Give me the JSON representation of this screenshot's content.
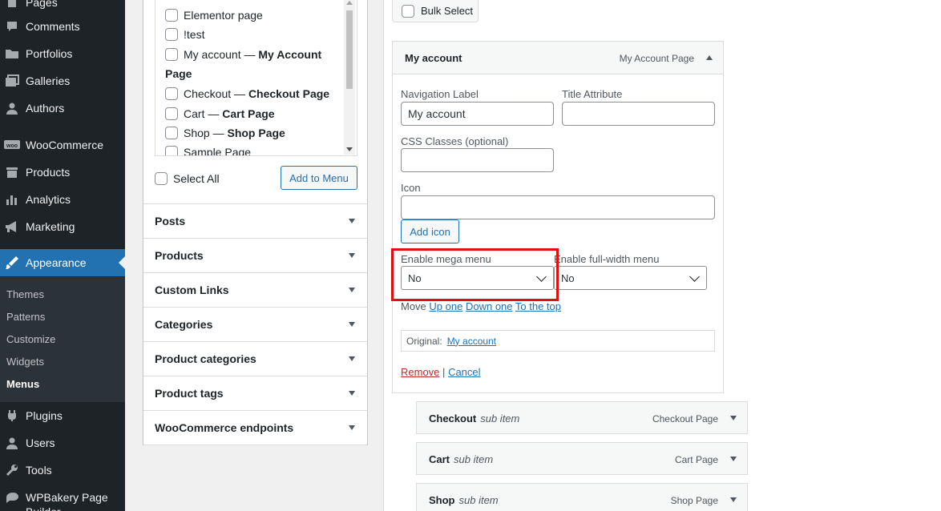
{
  "sidebar": {
    "items": [
      {
        "label": "Pages",
        "icon": "pages-icon"
      },
      {
        "label": "Comments",
        "icon": "comments-icon"
      },
      {
        "label": "Portfolios",
        "icon": "portfolio-icon"
      },
      {
        "label": "Galleries",
        "icon": "galleries-icon"
      },
      {
        "label": "Authors",
        "icon": "authors-icon"
      },
      {
        "label": "WooCommerce",
        "icon": "woocommerce-icon"
      },
      {
        "label": "Products",
        "icon": "products-icon"
      },
      {
        "label": "Analytics",
        "icon": "analytics-icon"
      },
      {
        "label": "Marketing",
        "icon": "marketing-icon"
      },
      {
        "label": "Appearance",
        "icon": "appearance-icon"
      },
      {
        "label": "Plugins",
        "icon": "plugins-icon"
      },
      {
        "label": "Users",
        "icon": "users-icon"
      },
      {
        "label": "Tools",
        "icon": "tools-icon"
      },
      {
        "label": "WPBakery Page Builder",
        "icon": "wpbakery-icon"
      }
    ],
    "submenu": [
      "Themes",
      "Patterns",
      "Customize",
      "Widgets",
      "Menus"
    ],
    "current": "Appearance",
    "current_sub": "Menus"
  },
  "pages_box": {
    "items": [
      {
        "plain": "Elementor page",
        "bold": ""
      },
      {
        "plain": "!test",
        "bold": ""
      },
      {
        "plain": "My account — ",
        "bold": "My Account"
      },
      {
        "plain": "",
        "bold": "Page"
      },
      {
        "plain": "Checkout — ",
        "bold": "Checkout Page"
      },
      {
        "plain": "Cart — ",
        "bold": "Cart Page"
      },
      {
        "plain": "Shop — ",
        "bold": "Shop Page"
      },
      {
        "plain": "Sample Page",
        "bold": ""
      }
    ],
    "select_all_label": "Select All",
    "add_to_menu_label": "Add to Menu"
  },
  "accordion": [
    "Posts",
    "Products",
    "Custom Links",
    "Categories",
    "Product categories",
    "Product tags",
    "WooCommerce endpoints"
  ],
  "bulk_select_label": "Bulk Select",
  "menu_item": {
    "title": "My account",
    "type": "My Account Page",
    "nav_label_label": "Navigation Label",
    "nav_label_value": "My account",
    "title_attr_label": "Title Attribute",
    "title_attr_value": "",
    "css_classes_label": "CSS Classes (optional)",
    "css_classes_value": "",
    "icon_label": "Icon",
    "icon_value": "",
    "add_icon_label": "Add icon",
    "mega_menu_label": "Enable mega menu",
    "mega_menu_value": "No",
    "full_width_label": "Enable full-width menu",
    "full_width_value": "No",
    "move_label": "Move",
    "move_up": "Up one",
    "move_down": "Down one",
    "move_top": "To the top",
    "original_label": "Original:",
    "original_link": "My account",
    "remove_label": "Remove",
    "separator": "|",
    "cancel_label": "Cancel"
  },
  "sub_items": [
    {
      "title": "Checkout",
      "sub": "sub item",
      "type": "Checkout Page"
    },
    {
      "title": "Cart",
      "sub": "sub item",
      "type": "Cart Page"
    },
    {
      "title": "Shop",
      "sub": "sub item",
      "type": "Shop Page"
    }
  ],
  "colors": {
    "admin_bg": "#1d2327",
    "accent": "#2271b1",
    "highlight": "#e01010"
  }
}
